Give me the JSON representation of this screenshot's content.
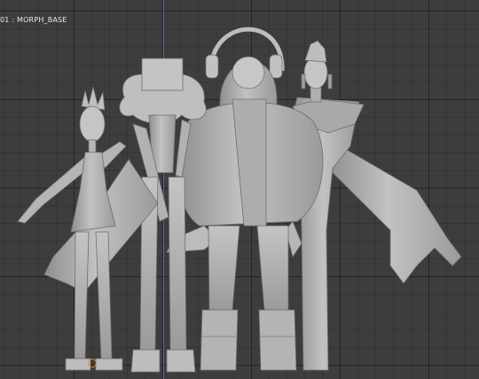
{
  "viewport": {
    "object_label": "01 : MORPH_BASE",
    "axis_color": "#5b77a8",
    "background": "#3d3d3d",
    "model_color": "#b9b9b9",
    "origin_color": "#e28a2c"
  },
  "icons": {
    "origin": "origin-marker-icon"
  }
}
